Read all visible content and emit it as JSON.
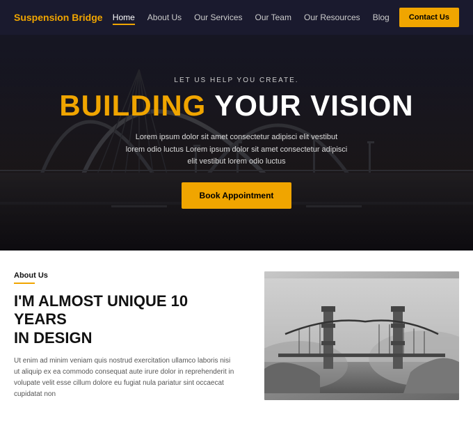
{
  "navbar": {
    "logo": "Suspension Bridge",
    "links": [
      {
        "label": "Home",
        "active": true
      },
      {
        "label": "About Us",
        "active": false
      },
      {
        "label": "Our Services",
        "active": false
      },
      {
        "label": "Our Team",
        "active": false
      },
      {
        "label": "Our Resources",
        "active": false
      },
      {
        "label": "Blog",
        "active": false
      }
    ],
    "contact_label": "Contact Us"
  },
  "hero": {
    "subtitle": "LET US HELP YOU CREATE.",
    "title_highlight": "BUILDING",
    "title_rest": " YOUR VISION",
    "description": "Lorem ipsum dolor sit amet consectetur adipisci elit vestibut lorem odio luctus Lorem ipsum dolor sit amet consectetur adipisci elit vestibut lorem odio luctus",
    "cta_label": "Book Appointment"
  },
  "about": {
    "section_label": "About Us",
    "heading_line1": "I'M ALMOST UNIQUE 10 YEARS",
    "heading_line2": "IN DESIGN",
    "description": "Ut enim ad minim veniam quis nostrud exercitation ullamco laboris nisi ut aliquip ex ea commodo consequat aute irure dolor in reprehenderit in volupate velit esse cillum dolore eu fugiat nula pariatur sint occaecat cupidatat non"
  }
}
